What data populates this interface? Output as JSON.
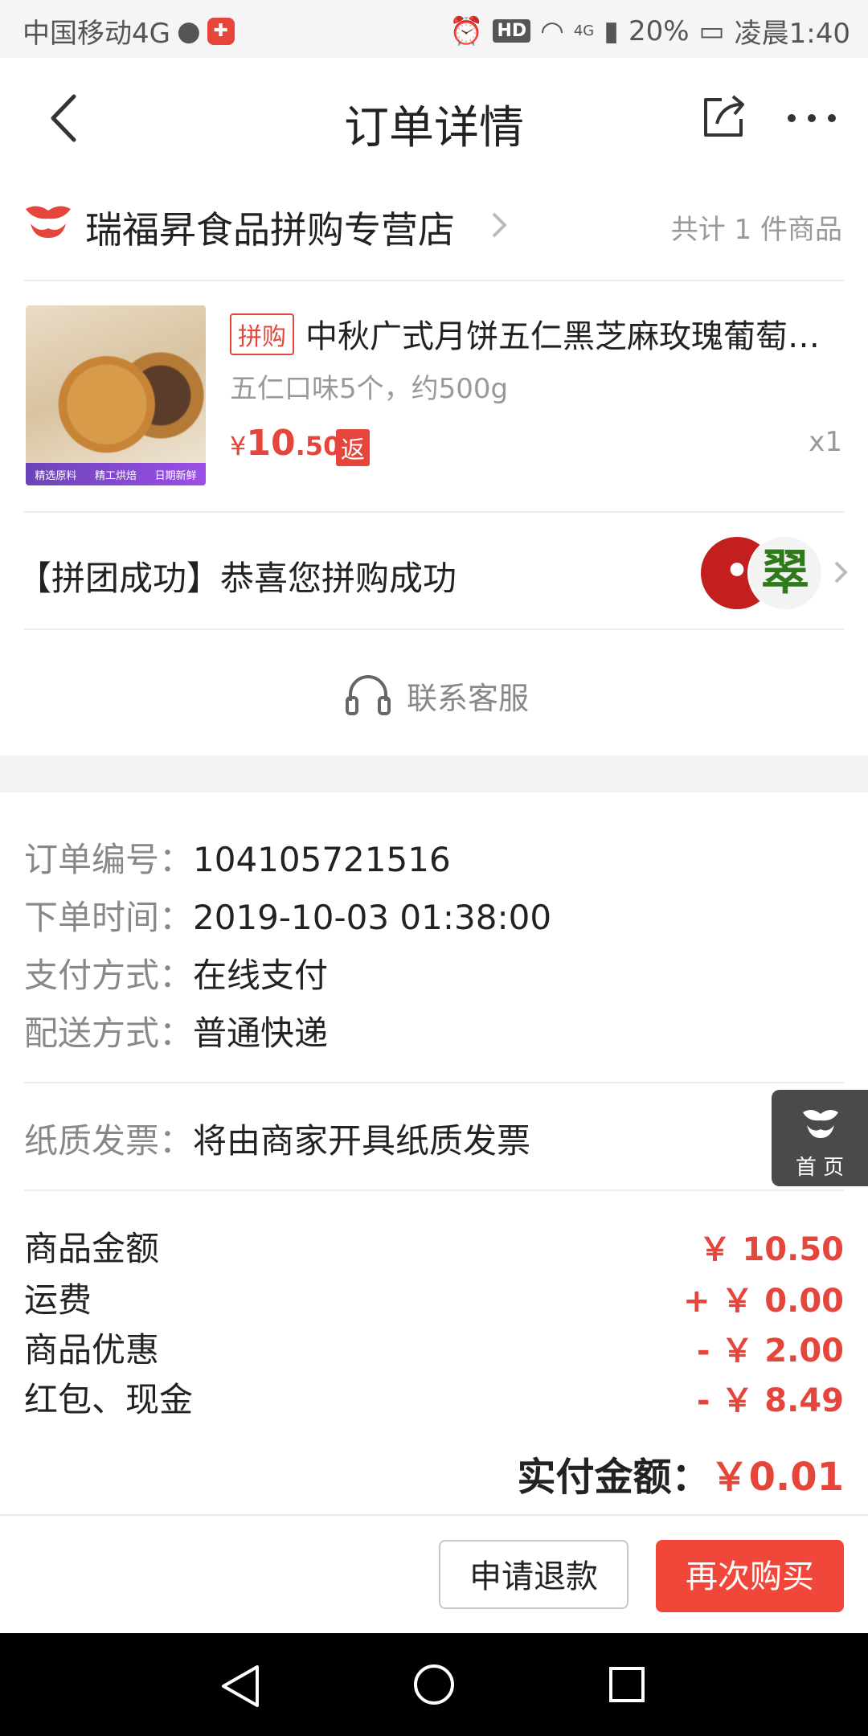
{
  "status_bar": {
    "carrier": "中国移动4G",
    "hd_badge": "HD",
    "network": "4G",
    "battery": "20%",
    "time": "凌晨1:40"
  },
  "header": {
    "title": "订单详情"
  },
  "store": {
    "name": "瑞福昇食品拼购专营店",
    "count_text": "共计 1 件商品"
  },
  "product": {
    "tag": "拼购",
    "title": "中秋广式月饼五仁黑芝麻玫瑰葡萄…",
    "spec": "五仁口味5个，约500g",
    "price_currency": "¥",
    "price_int": "10",
    "price_dec": ".50",
    "rebate_badge": "返",
    "quantity": "x1",
    "image_strip": [
      "精选原料",
      "精工烘焙",
      "日期新鲜"
    ]
  },
  "group": {
    "status_text": "【拼团成功】恭喜您拼购成功",
    "avatar2_char": "翠"
  },
  "service": {
    "label": "联系客服"
  },
  "order_info": {
    "order_no_label": "订单编号：",
    "order_no": "104105721516",
    "time_label": "下单时间：",
    "time": "2019-10-03 01:38:00",
    "payment_label": "支付方式：",
    "payment": "在线支付",
    "delivery_label": "配送方式：",
    "delivery": "普通快递",
    "invoice_label": "纸质发票：",
    "invoice": "将由商家开具纸质发票"
  },
  "fees": [
    {
      "label": "商品金额",
      "value": "￥ 10.50"
    },
    {
      "label": "运费",
      "value": "+ ￥ 0.00"
    },
    {
      "label": "商品优惠",
      "value": "- ￥ 2.00"
    },
    {
      "label": "红包、现金",
      "value": "- ￥ 8.49"
    }
  ],
  "total": {
    "label": "实付金额：",
    "value": "￥0.01"
  },
  "home_fab": {
    "label": "首 页"
  },
  "actions": {
    "refund": "申请退款",
    "rebuy": "再次购买"
  },
  "colors": {
    "accent_red": "#e5453a",
    "button_red": "#f1473b",
    "muted_text": "#999999"
  }
}
